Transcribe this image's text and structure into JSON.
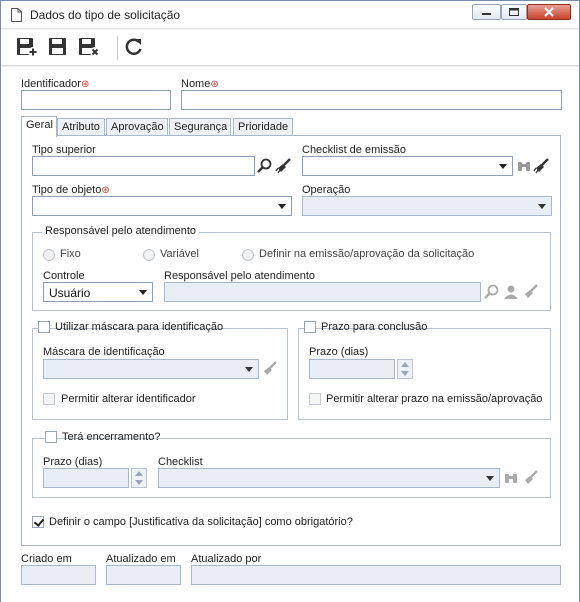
{
  "window": {
    "title": "Dados do tipo de solicitação"
  },
  "toolbar": {
    "items": [
      "save-new-icon",
      "save-icon",
      "save-close-icon",
      "refresh-icon"
    ]
  },
  "header": {
    "identifier_label": "Identificador",
    "name_label": "Nome"
  },
  "tabs": [
    {
      "label": "Geral"
    },
    {
      "label": "Atributo"
    },
    {
      "label": "Aprovação"
    },
    {
      "label": "Segurança"
    },
    {
      "label": "Prioridade"
    }
  ],
  "general": {
    "tipo_superior": "Tipo superior",
    "checklist_emissao": "Checklist de emissão",
    "tipo_objeto": "Tipo de objeto",
    "operacao": "Operação",
    "responsavel_group": "Responsável pelo atendimento",
    "radio_fixo": "Fixo",
    "radio_variavel": "Variável",
    "radio_definir": "Definir na emissão/aprovação da solicitação",
    "controle_label": "Controle",
    "controle_value": "Usuário",
    "responsavel_label": "Responsável pelo atendimento",
    "mascara_group": "Utilizar máscara para identificação",
    "mascara_label": "Máscara de identificação",
    "permitir_identificador": "Permitir alterar identificador",
    "prazo_group": "Prazo para conclusão",
    "prazo_dias": "Prazo (dias)",
    "permitir_prazo": "Permitir alterar prazo na emissão/aprovação",
    "encerramento_group": "Terá encerramento?",
    "encerramento_prazo": "Prazo (dias)",
    "encerramento_checklist": "Checklist",
    "justificativa": "Definir o campo [Justificativa da solicitação] como obrigatório?",
    "justificativa_checked": true
  },
  "footer": {
    "criado_em": "Criado em",
    "atualizado_em": "Atualizado em",
    "atualizado_por": "Atualizado por"
  },
  "colors": {
    "accent": "#8e9fb5",
    "required": "#d2322d",
    "disabled_bg": "#e9eef4"
  }
}
